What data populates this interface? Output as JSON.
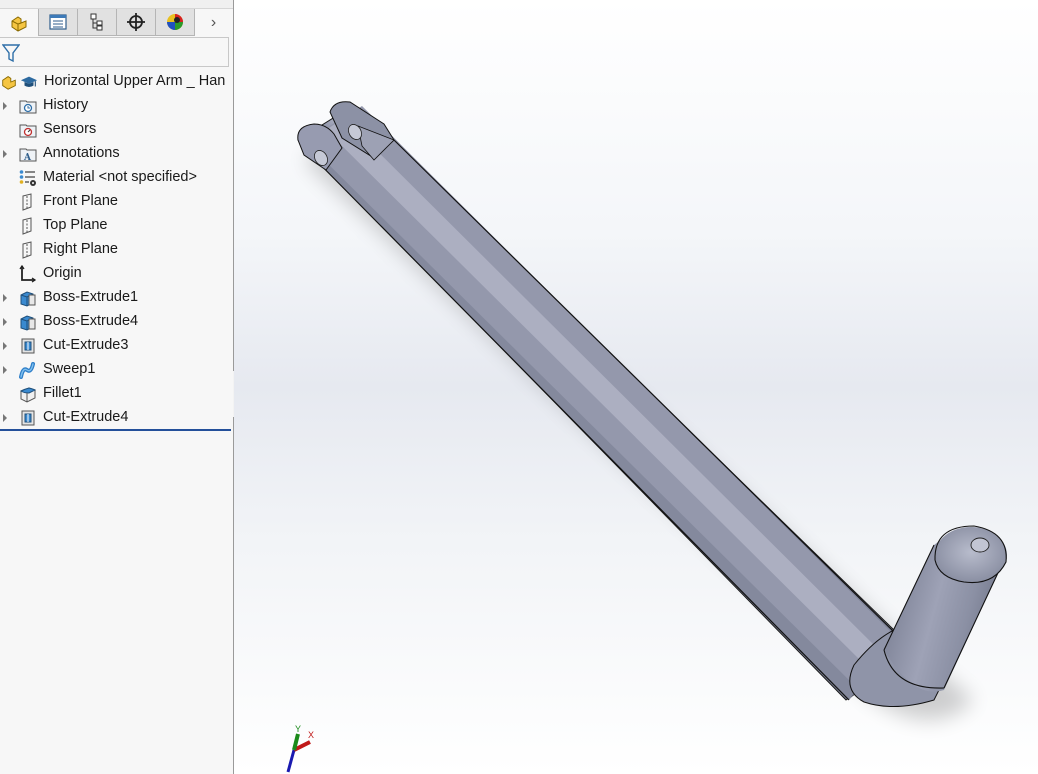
{
  "feature_manager": {
    "tabs": [
      {
        "name": "FeatureManager Design Tree",
        "icon": "part-icon",
        "active": true
      },
      {
        "name": "PropertyManager",
        "icon": "property-manager-icon",
        "active": false
      },
      {
        "name": "ConfigurationManager",
        "icon": "configuration-manager-icon",
        "active": false
      },
      {
        "name": "DimXpertManager",
        "icon": "dimxpert-icon",
        "active": false
      },
      {
        "name": "DisplayManager",
        "icon": "display-manager-icon",
        "active": false
      }
    ],
    "more_tabs_glyph": "›",
    "filter_icon": "filter-icon",
    "root": {
      "label": "Horizontal Upper Arm _ Han",
      "icon": "part-icon"
    },
    "items": [
      {
        "label": "History",
        "icon": "history-folder-icon",
        "expandable": true
      },
      {
        "label": "Sensors",
        "icon": "sensors-folder-icon",
        "expandable": false
      },
      {
        "label": "Annotations",
        "icon": "annotations-folder-icon",
        "expandable": true
      },
      {
        "label": "Material <not specified>",
        "icon": "material-icon",
        "expandable": false
      },
      {
        "label": "Front Plane",
        "icon": "plane-icon",
        "expandable": false
      },
      {
        "label": "Top Plane",
        "icon": "plane-icon",
        "expandable": false
      },
      {
        "label": "Right Plane",
        "icon": "plane-icon",
        "expandable": false
      },
      {
        "label": "Origin",
        "icon": "origin-icon",
        "expandable": false
      },
      {
        "label": "Boss-Extrude1",
        "icon": "boss-extrude-icon",
        "expandable": true
      },
      {
        "label": "Boss-Extrude4",
        "icon": "boss-extrude-icon",
        "expandable": true
      },
      {
        "label": "Cut-Extrude3",
        "icon": "cut-extrude-icon",
        "expandable": true
      },
      {
        "label": "Sweep1",
        "icon": "sweep-icon",
        "expandable": true
      },
      {
        "label": "Fillet1",
        "icon": "fillet-icon",
        "expandable": false
      },
      {
        "label": "Cut-Extrude4",
        "icon": "cut-extrude-icon",
        "expandable": true
      }
    ]
  },
  "viewport": {
    "model_name": "Horizontal Upper Arm",
    "model_color": "#8e93a6",
    "triad": {
      "x_label": "X",
      "y_label": "Y",
      "x_color": "#c01818",
      "y_color": "#1a8a1a",
      "z_color": "#1a1ab0"
    }
  }
}
